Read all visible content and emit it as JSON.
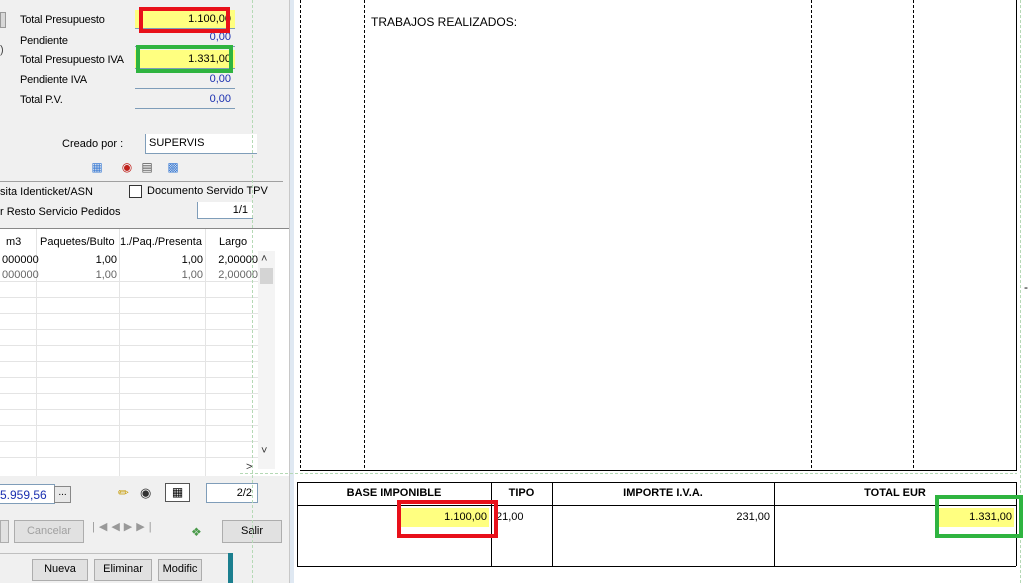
{
  "summary": {
    "total_presupuesto": {
      "label": "Total Presupuesto",
      "value": "1.100,00"
    },
    "pendiente": {
      "label": "Pendiente",
      "value": "0,00"
    },
    "total_presupuesto_iva": {
      "label": "Total Presupuesto IVA",
      "value": "1.331,00"
    },
    "pendiente_iva": {
      "label": "Pendiente IVA",
      "value": "0,00"
    },
    "total_pv": {
      "label": "Total P.V.",
      "value": "0,00"
    }
  },
  "creado_por": {
    "label": "Creado por :",
    "value": "SUPERVIS"
  },
  "options": {
    "visita_label": "sita Identicket/ASN",
    "documento_servido_label": "Documento Servido TPV",
    "resto_label": "r Resto Servicio Pedidos",
    "page_indicator": "1/1"
  },
  "grid": {
    "headers": [
      "m3",
      "Paquetes/Bulto",
      "1./Paq./Presenta",
      "Largo"
    ],
    "rows": [
      [
        "000000",
        "1,00",
        "1,00",
        "2,00000"
      ],
      [
        "000000",
        "1,00",
        "1,00",
        "2,00000"
      ]
    ]
  },
  "footer": {
    "total_value": "5.959,56",
    "ellipsis": "...",
    "page": "2/2"
  },
  "buttons": {
    "cancelar": "Cancelar",
    "salir": "Salir",
    "nueva": "Nueva",
    "eliminar": "Eliminar",
    "modificar": "Modific"
  },
  "document": {
    "section_label": "TRABAJOS REALIZADOS:",
    "table_headers": {
      "base": "BASE IMPONIBLE",
      "tipo": "TIPO",
      "importe": "IMPORTE I.V.A.",
      "total": "TOTAL EUR"
    },
    "table_values": {
      "base": "1.100,00",
      "tipo": "21,00",
      "importe": "231,00",
      "total": "1.331,00"
    }
  },
  "colors": {
    "highlight_red": "#e8101a",
    "highlight_green": "#2fb440",
    "field_yellow": "#ffff80",
    "value_blue": "#1a2fb0"
  }
}
